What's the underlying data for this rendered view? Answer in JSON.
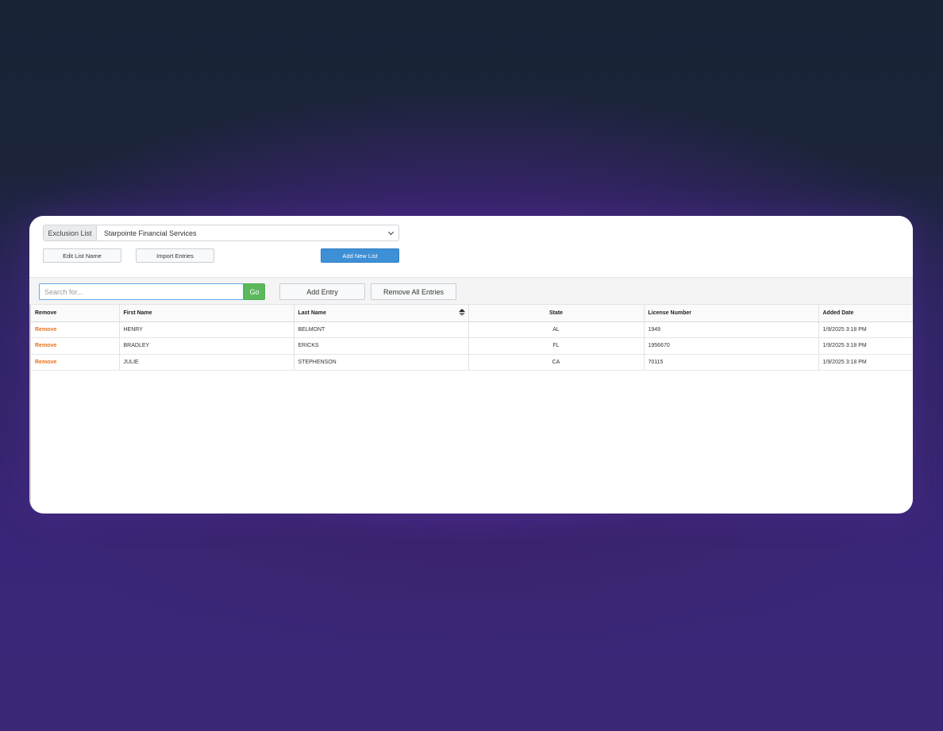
{
  "exclusion_list": {
    "label": "Exclusion List",
    "selected": "Starpointe Financial Services"
  },
  "actions": {
    "edit_list_name": "Edit List Name",
    "import_entries": "Import Entries",
    "add_new_list": "Add New List"
  },
  "search": {
    "placeholder": "Search for...",
    "go_label": "Go"
  },
  "toolbar": {
    "add_entry": "Add Entry",
    "remove_all_entries": "Remove All Entries"
  },
  "table": {
    "columns": [
      "Remove",
      "First Name",
      "Last Name",
      "State",
      "License Number",
      "Added Date"
    ],
    "sorted_column": "Last Name",
    "rows": [
      {
        "remove": "Remove",
        "first": "HENRY",
        "last": "BELMONT",
        "state": "AL",
        "license": "1949",
        "added": "1/9/2025 3:18 PM"
      },
      {
        "remove": "Remove",
        "first": "BRADLEY",
        "last": "ERICKS",
        "state": "FL",
        "license": "1956670",
        "added": "1/9/2025 3:18 PM"
      },
      {
        "remove": "Remove",
        "first": "JULIE",
        "last": "STEPHENSON",
        "state": "CA",
        "license": "70115",
        "added": "1/9/2025 3:18 PM"
      }
    ]
  },
  "colors": {
    "primary": "#3d8fd6",
    "go": "#5cb85c",
    "remove_link": "#e8711b"
  }
}
